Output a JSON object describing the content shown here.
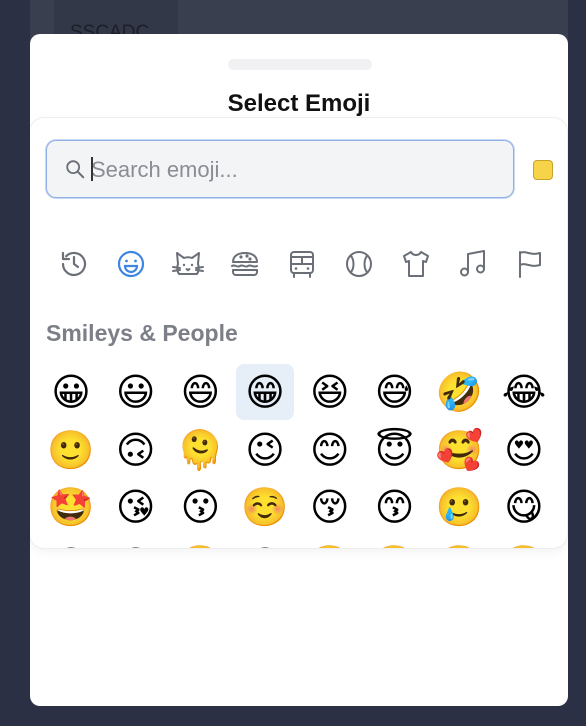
{
  "background_card": {
    "text": "SSCADC"
  },
  "sheet": {
    "title": "Select Emoji"
  },
  "search": {
    "placeholder": "Search emoji..."
  },
  "categories": [
    {
      "name": "recent-icon",
      "color": "#6b6f78"
    },
    {
      "name": "smileys-icon",
      "color": "#3f86e0",
      "active": true
    },
    {
      "name": "animals-icon",
      "color": "#6b6f78"
    },
    {
      "name": "food-icon",
      "color": "#6b6f78"
    },
    {
      "name": "travel-icon",
      "color": "#6b6f78"
    },
    {
      "name": "activity-icon",
      "color": "#6b6f78"
    },
    {
      "name": "objects-icon",
      "color": "#6b6f78"
    },
    {
      "name": "symbols-icon",
      "color": "#6b6f78"
    },
    {
      "name": "flags-icon",
      "color": "#6b6f78"
    }
  ],
  "section": {
    "label": "Smileys & People"
  },
  "emoji_rows": [
    [
      "😀",
      "😃",
      "😄",
      "😁",
      "😆",
      "😅",
      "🤣",
      "😂"
    ],
    [
      "🙂",
      "🙃",
      "🫠",
      "😉",
      "😊",
      "😇",
      "🥰",
      "😍"
    ],
    [
      "🤩",
      "😘",
      "😗",
      "☺️",
      "😚",
      "😙",
      "🥲",
      "😋"
    ],
    [
      "😛",
      "😜",
      "🤪",
      "😝",
      "🤑",
      "🤗",
      "🤭",
      "🫢"
    ]
  ],
  "selected_emoji": "😁",
  "tone_color": "#f6d349"
}
